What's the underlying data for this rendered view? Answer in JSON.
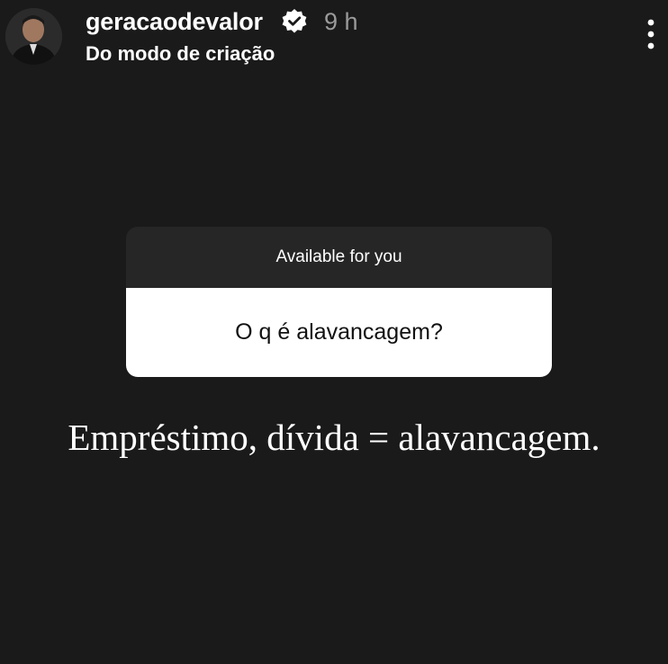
{
  "header": {
    "avatar_icon": "profile-photo",
    "username": "geracaodevalor",
    "verified_icon": "verified-badge-icon",
    "time": "9 h",
    "subtitle": "Do modo de criação",
    "more_icon": "more-options-icon"
  },
  "question_card": {
    "header": "Available for you",
    "question": "O q é alavancagem?"
  },
  "answer": "Empréstimo, dívida = alavancagem.",
  "colors": {
    "background": "#1a1a1a",
    "card_header": "#262626",
    "card_body": "#ffffff",
    "timestamp": "#9a9a9a"
  }
}
